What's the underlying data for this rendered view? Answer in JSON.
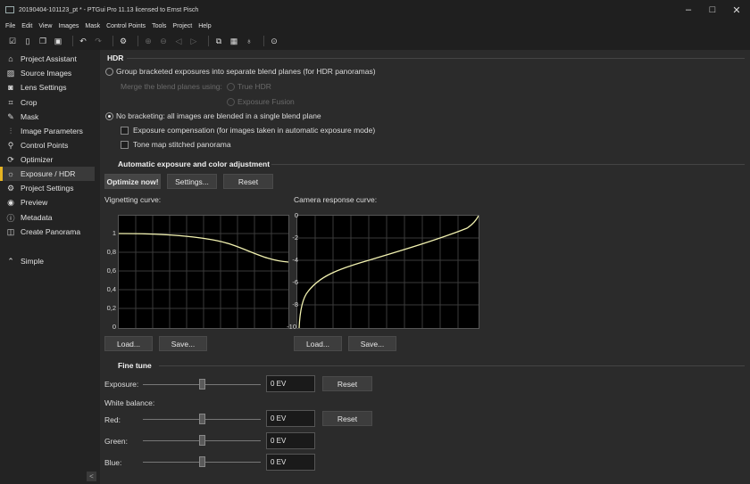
{
  "window": {
    "title": "20190404-101123_pt * - PTGui Pro 11.13 licensed to Ernst Pisch",
    "minimize": "–",
    "maximize": "□",
    "close": "✕"
  },
  "menu": [
    "File",
    "Edit",
    "View",
    "Images",
    "Mask",
    "Control Points",
    "Tools",
    "Project",
    "Help"
  ],
  "sidebar": {
    "items": [
      {
        "label": "Project Assistant",
        "icon": "home-icon"
      },
      {
        "label": "Source Images",
        "icon": "images-icon"
      },
      {
        "label": "Lens Settings",
        "icon": "camera-icon"
      },
      {
        "label": "Crop",
        "icon": "crop-icon"
      },
      {
        "label": "Mask",
        "icon": "brush-icon"
      },
      {
        "label": "Image Parameters",
        "icon": "sliders-icon"
      },
      {
        "label": "Control Points",
        "icon": "control-points-icon"
      },
      {
        "label": "Optimizer",
        "icon": "optimizer-icon"
      },
      {
        "label": "Exposure / HDR",
        "icon": "sun-icon"
      },
      {
        "label": "Project Settings",
        "icon": "gear-icon"
      },
      {
        "label": "Preview",
        "icon": "eye-icon"
      },
      {
        "label": "Metadata",
        "icon": "info-icon"
      },
      {
        "label": "Create Panorama",
        "icon": "panorama-icon"
      }
    ],
    "active": "Exposure / HDR",
    "simple": "Simple"
  },
  "hdr": {
    "heading": "HDR",
    "group_option": "Group bracketed exposures into separate blend planes (for HDR panoramas)",
    "merge_label": "Merge the blend planes using:",
    "true_hdr": "True HDR",
    "exposure_fusion": "Exposure Fusion",
    "no_bracketing": "No bracketing: all images are blended in a single blend plane",
    "exposure_comp": "Exposure compensation (for images taken in automatic exposure mode)",
    "tone_map": "Tone map stitched panorama"
  },
  "auto": {
    "heading": "Automatic exposure and color adjustment",
    "optimize": "Optimize now!",
    "settings": "Settings...",
    "reset": "Reset",
    "vignetting_label": "Vignetting curve:",
    "response_label": "Camera response curve:",
    "load": "Load...",
    "save": "Save...",
    "vignetting_ticks": [
      "1",
      "0,8",
      "0,6",
      "0,4",
      "0,2",
      "0"
    ],
    "response_ticks": [
      "0",
      "-2",
      "-4",
      "-6",
      "-8",
      "-10"
    ]
  },
  "finetune": {
    "heading": "Fine tune",
    "exposure_label": "Exposure:",
    "exposure_value": "0 EV",
    "reset": "Reset",
    "wb_label": "White balance:",
    "red_label": "Red:",
    "red_value": "0 EV",
    "green_label": "Green:",
    "green_value": "0 EV",
    "blue_label": "Blue:",
    "blue_value": "0 EV"
  },
  "colors": {
    "accent": "#e6b422",
    "curve": "#f2f2b0"
  }
}
